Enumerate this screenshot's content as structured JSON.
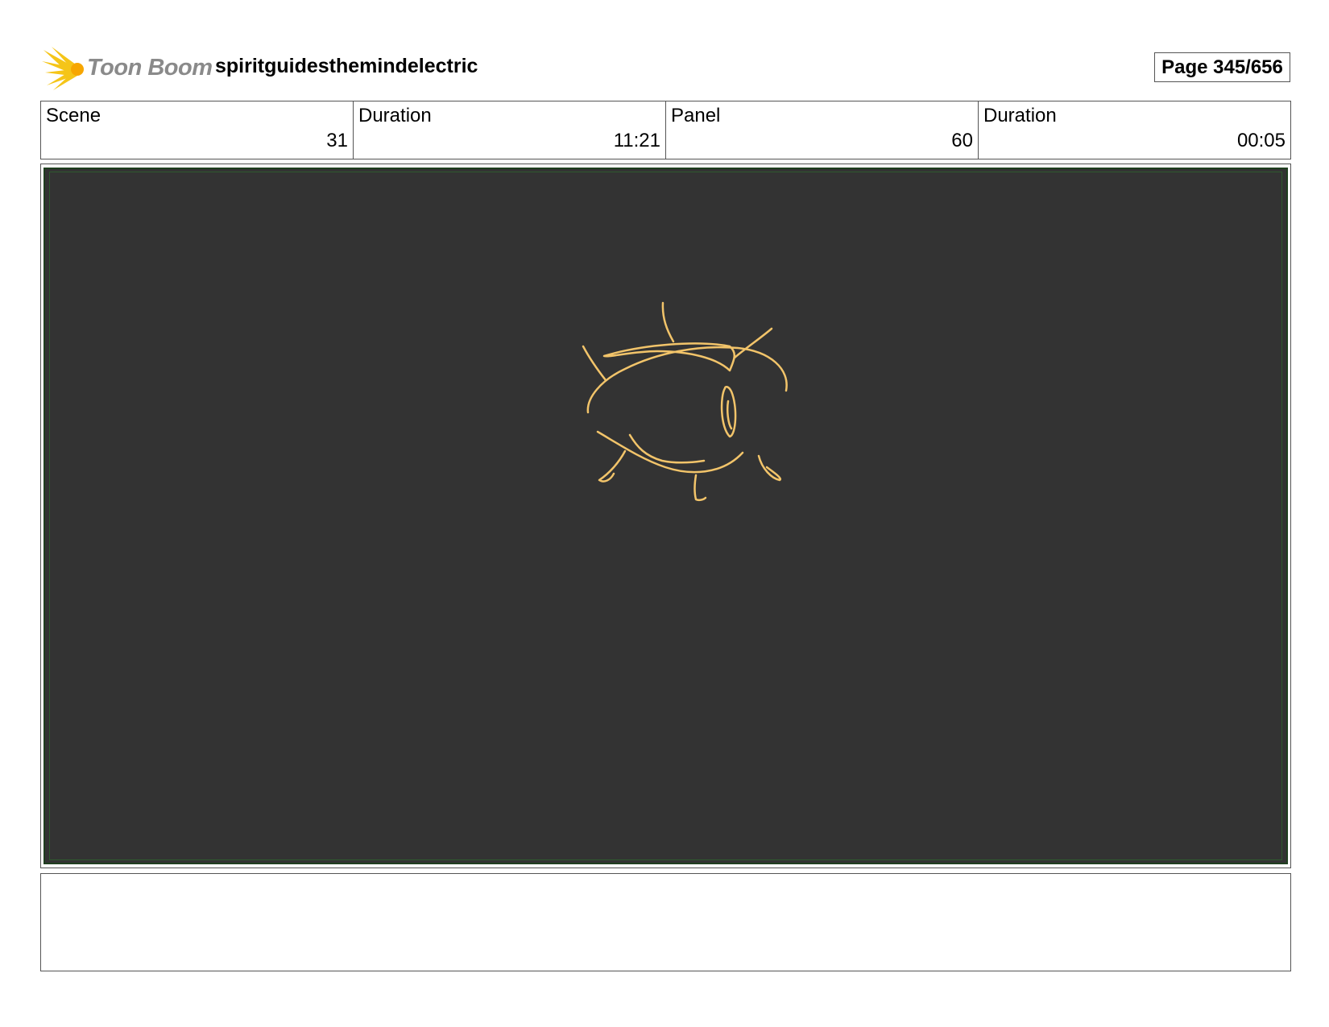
{
  "header": {
    "logo_text": "Toon Boom",
    "project_title": "spiritguidesthemindelectric",
    "page_label": "Page 345/656"
  },
  "info": [
    {
      "label": "Scene",
      "value": "31"
    },
    {
      "label": "Duration",
      "value": "11:21"
    },
    {
      "label": "Panel",
      "value": "60"
    },
    {
      "label": "Duration",
      "value": "00:05"
    }
  ],
  "colors": {
    "panel_background": "#333333",
    "sketch_stroke": "#f2c46a",
    "logo_burst": "#f5c518"
  },
  "notes": {
    "text": ""
  }
}
